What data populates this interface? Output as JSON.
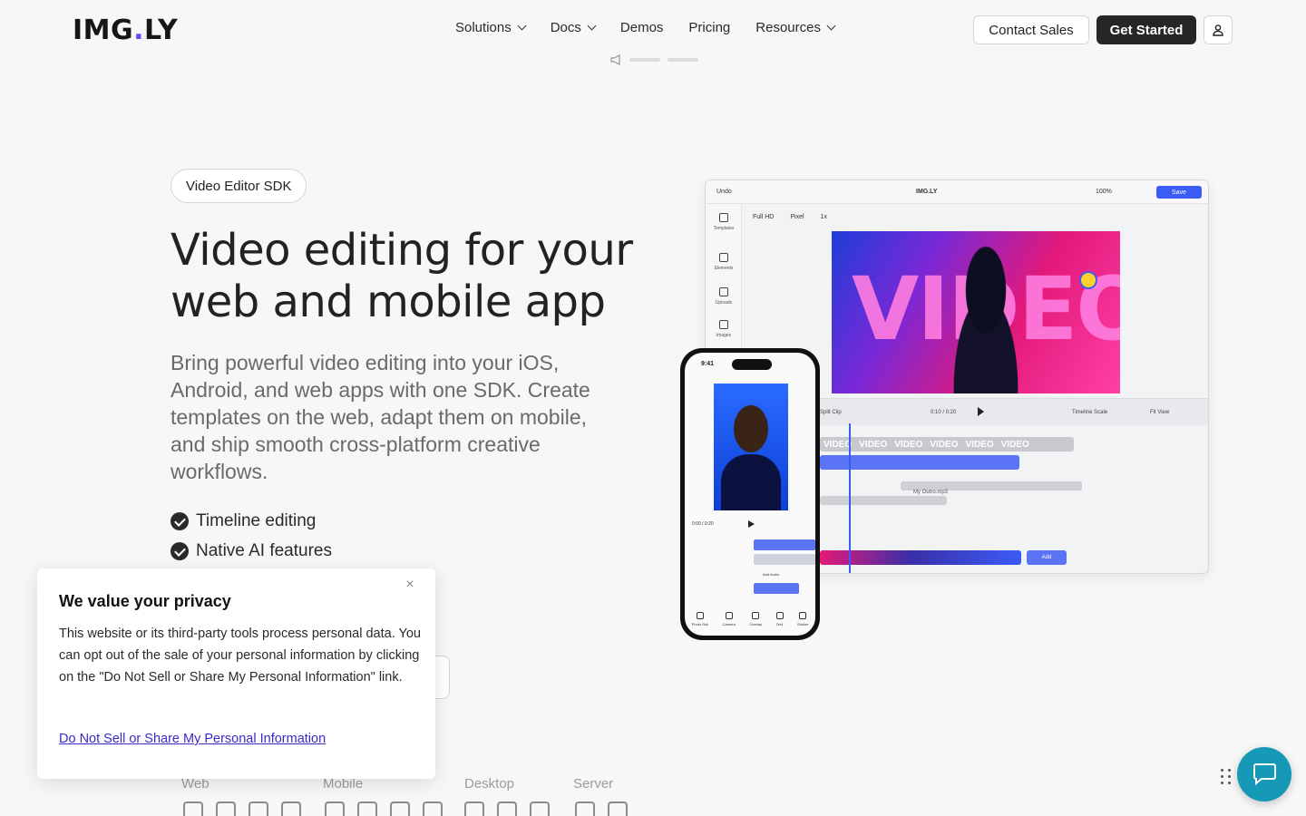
{
  "brand": {
    "logo_left": "IMG",
    "logo_dot": ".",
    "logo_right": "LY"
  },
  "nav": {
    "items": [
      {
        "label": "Solutions",
        "has_dropdown": true
      },
      {
        "label": "Docs",
        "has_dropdown": true
      },
      {
        "label": "Demos",
        "has_dropdown": false
      },
      {
        "label": "Pricing",
        "has_dropdown": false
      },
      {
        "label": "Resources",
        "has_dropdown": true
      }
    ],
    "contact_label": "Contact Sales",
    "start_label": "Get Started"
  },
  "hero": {
    "badge": "Video Editor SDK",
    "title": "Video editing for your web and mobile app",
    "subtitle": "Bring powerful video editing into your iOS, Android, and web apps with one SDK. Create templates on the web, adapt them on mobile, and ship smooth cross-platform creative workflows.",
    "features": [
      "Timeline editing",
      "Native AI features"
    ]
  },
  "platforms": {
    "labels": [
      "Web",
      "Mobile",
      "Desktop",
      "Server"
    ]
  },
  "editor": {
    "undo": "Undo",
    "brand": "IMG.LY",
    "zoom": "100%",
    "save": "Save",
    "format": "Full HD",
    "unit": "Pixel",
    "scale": "1x",
    "tools": [
      "Templates",
      "Elements",
      "Uploads",
      "Images"
    ],
    "canvas_text": "VIDEO",
    "split": "Split Clip",
    "time": "0:10 / 0:20",
    "timeline_scale": "Timeline Scale",
    "fit_view": "Fit View",
    "track_label": "VIDEO",
    "audio_label": "My Outro.mp3",
    "add_label": "Add"
  },
  "phone": {
    "time": "9:41",
    "clock": "0:00 / 0:20",
    "add_audio": "Add Audio",
    "tabs": [
      "Photo Roll",
      "Camera",
      "Overlay",
      "Text",
      "Sticker"
    ]
  },
  "privacy": {
    "title": "We value your privacy",
    "body": "This website or its third-party tools process personal data. You can opt out of the sale of your personal information by clicking on the \"Do Not Sell or Share My Personal Information\" link.",
    "link": "Do Not Sell or Share My Personal Information",
    "close": "×"
  },
  "colors": {
    "accent": "#5b4cf5",
    "primary_button": "#262626",
    "chat": "#1699b7",
    "link": "#3a2bc9"
  }
}
